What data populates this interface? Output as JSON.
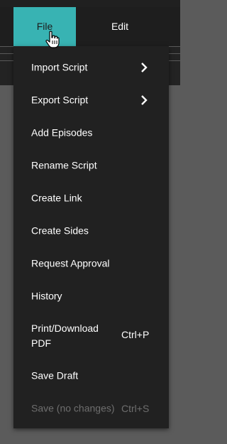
{
  "menubar": {
    "tabs": [
      {
        "label": "File",
        "active": true
      },
      {
        "label": "Edit",
        "active": false
      }
    ]
  },
  "file_menu": {
    "items": [
      {
        "label": "Import Script",
        "submenu": true
      },
      {
        "label": "Export Script",
        "submenu": true
      },
      {
        "label": "Add Episodes"
      },
      {
        "label": "Rename Script"
      },
      {
        "label": "Create Link"
      },
      {
        "label": "Create Sides"
      },
      {
        "label": "Request Approval"
      },
      {
        "label": "History"
      },
      {
        "label": "Print/Download PDF",
        "label_line1": "Print/Download",
        "label_line2": "PDF",
        "shortcut": "Ctrl+P"
      },
      {
        "label": "Save Draft"
      },
      {
        "label": "Save (no changes)",
        "shortcut": "Ctrl+S",
        "disabled": true
      }
    ]
  },
  "colors": {
    "accent": "#38b3b3",
    "menu_bg": "#212121",
    "page_bg": "#5b5b5b",
    "disabled_text": "#6e6e6e"
  },
  "icons": {
    "submenu": "chevron-right-icon",
    "pointer": "hand-pointer-icon"
  }
}
